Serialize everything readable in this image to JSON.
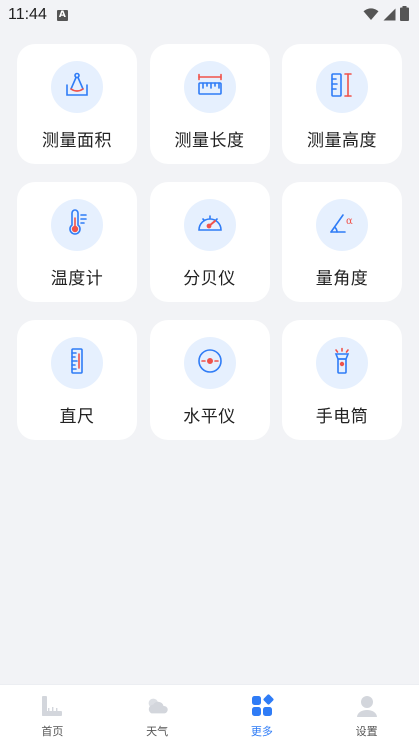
{
  "status_bar": {
    "time": "11:44",
    "notification_badge": "A"
  },
  "tools": [
    {
      "label": "测量面积",
      "icon": "area-measure-icon"
    },
    {
      "label": "测量长度",
      "icon": "ruler-length-icon"
    },
    {
      "label": "测量高度",
      "icon": "height-measure-icon"
    },
    {
      "label": "温度计",
      "icon": "thermometer-icon"
    },
    {
      "label": "分贝仪",
      "icon": "decibel-meter-icon"
    },
    {
      "label": "量角度",
      "icon": "protractor-angle-icon"
    },
    {
      "label": "直尺",
      "icon": "straight-ruler-icon"
    },
    {
      "label": "水平仪",
      "icon": "spirit-level-icon"
    },
    {
      "label": "手电筒",
      "icon": "flashlight-icon"
    }
  ],
  "bottom_nav": [
    {
      "label": "首页",
      "icon": "home-ruler-icon",
      "active": false
    },
    {
      "label": "天气",
      "icon": "weather-icon",
      "active": false
    },
    {
      "label": "更多",
      "icon": "more-grid-icon",
      "active": true
    },
    {
      "label": "设置",
      "icon": "profile-settings-icon",
      "active": false
    }
  ],
  "colors": {
    "background": "#f2f3f6",
    "card": "#ffffff",
    "icon_circle": "#e6f0fe",
    "icon_blue": "#2f7cf6",
    "icon_red": "#f0524a",
    "active_nav": "#2f7cf6"
  }
}
